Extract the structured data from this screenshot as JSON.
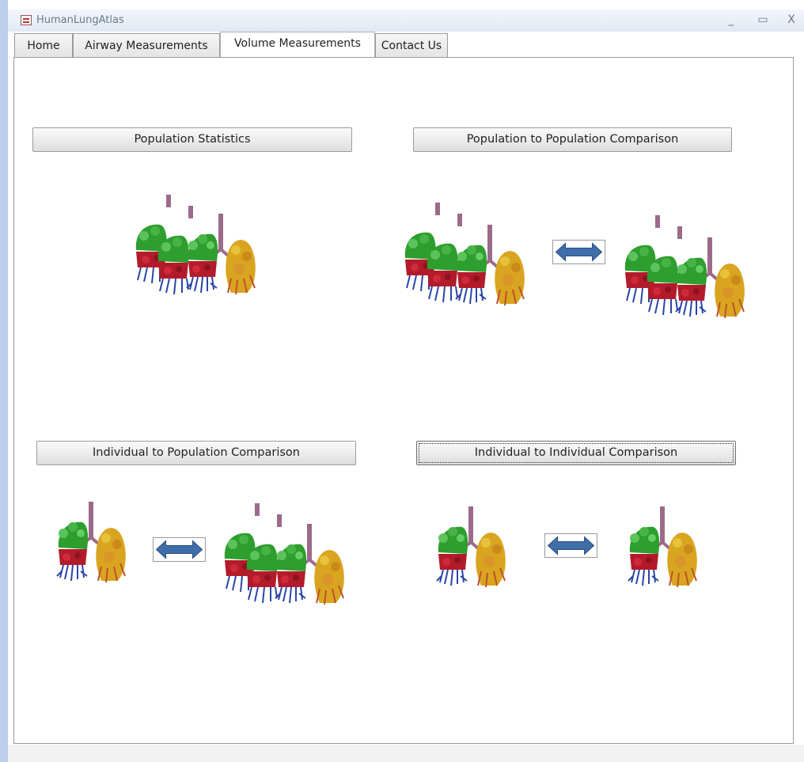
{
  "window": {
    "title": "HumanLungAtlas",
    "minimize": "_",
    "maximize": "▭",
    "close": "X"
  },
  "tabs": [
    {
      "label": "Home"
    },
    {
      "label": "Airway Measurements"
    },
    {
      "label": "Volume Measurements"
    },
    {
      "label": "Contact Us"
    }
  ],
  "active_tab": "Volume Measurements",
  "buttons": {
    "population_statistics": "Population Statistics",
    "population_to_population": "Population to Population Comparison",
    "individual_to_population": "Individual to Population Comparison",
    "individual_to_individual": "Individual to Individual Comparison"
  },
  "colors": {
    "upper_lobe": "#2e9e2e",
    "lower_lobe": "#b31b2b",
    "airways": "#2b45a8",
    "left_lung": "#d9a520",
    "trachea": "#9c6a8a",
    "arrow": "#3f6ea8"
  }
}
